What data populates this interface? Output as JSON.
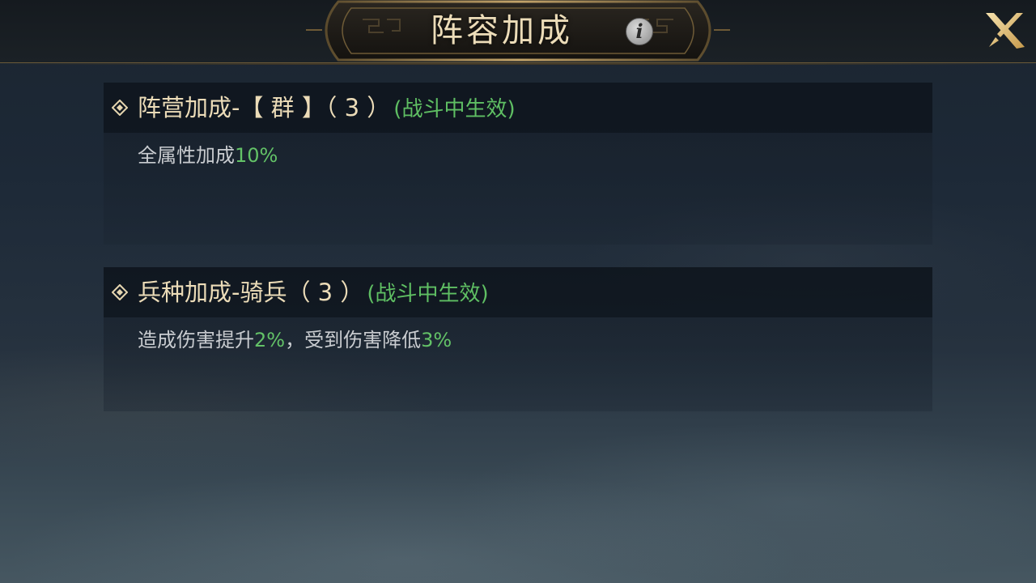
{
  "header": {
    "title": "阵容加成",
    "info_icon": "info-icon",
    "close_icon": "close-icon"
  },
  "bonuses": [
    {
      "title": "阵营加成-【 群 】（ 3 ）",
      "note": "(战斗中生效)",
      "desc": {
        "t1": "全属性加成",
        "v1": "10%"
      }
    },
    {
      "title": "兵种加成-骑兵（ 3 ）",
      "note": "(战斗中生效)",
      "desc": {
        "t1": "造成伤害提升",
        "v1": "2%",
        "t2": "，受到伤害降低",
        "v2": "3%"
      }
    }
  ],
  "colors": {
    "gold_text": "#ecdcb8",
    "green_highlight": "#63c267",
    "body_text": "#c9ccd0"
  }
}
